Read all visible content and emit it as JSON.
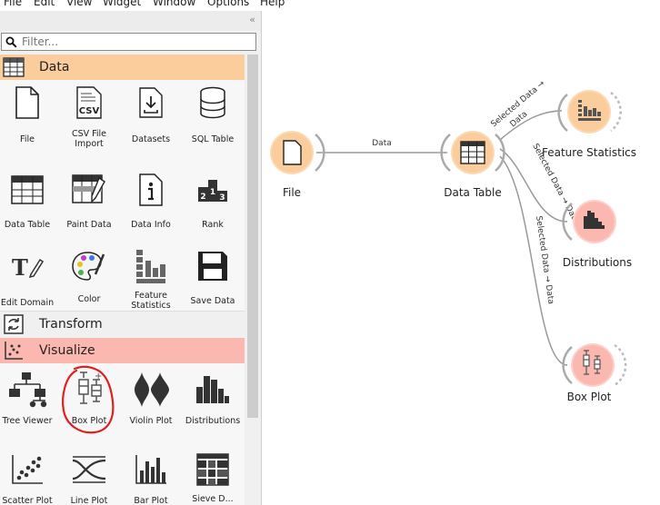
{
  "menubar": {
    "items": [
      "File",
      "Edit",
      "View",
      "Widget",
      "Window",
      "Options",
      "Help"
    ]
  },
  "panel": {
    "collapse_glyph": "«",
    "filter_placeholder": "Filter..."
  },
  "categories": {
    "data": {
      "label": "Data",
      "color": "#fbcd9c",
      "widgets": [
        {
          "label": "File",
          "icon": "file-icon"
        },
        {
          "label": "CSV File Import",
          "icon": "csv-icon"
        },
        {
          "label": "Datasets",
          "icon": "datasets-icon"
        },
        {
          "label": "SQL Table",
          "icon": "database-icon"
        },
        {
          "label": "Data Table",
          "icon": "table-icon"
        },
        {
          "label": "Paint Data",
          "icon": "paint-icon"
        },
        {
          "label": "Data Info",
          "icon": "info-icon"
        },
        {
          "label": "Rank",
          "icon": "rank-icon"
        },
        {
          "label": "Edit Domain",
          "icon": "edit-domain-icon"
        },
        {
          "label": "Color",
          "icon": "palette-icon"
        },
        {
          "label": "Feature Statistics",
          "icon": "feature-stats-icon"
        },
        {
          "label": "Save Data",
          "icon": "save-icon"
        }
      ]
    },
    "transform": {
      "label": "Transform"
    },
    "visualize": {
      "label": "Visualize",
      "color": "#fbb8b0",
      "widgets": [
        {
          "label": "Tree Viewer",
          "icon": "tree-icon"
        },
        {
          "label": "Box Plot",
          "icon": "boxplot-icon"
        },
        {
          "label": "Violin Plot",
          "icon": "violin-icon"
        },
        {
          "label": "Distributions",
          "icon": "distributions-icon"
        },
        {
          "label": "Scatter Plot",
          "icon": "scatter-icon"
        },
        {
          "label": "Line Plot",
          "icon": "lineplot-icon"
        },
        {
          "label": "Bar Plot",
          "icon": "barplot-icon"
        },
        {
          "label": "Sieve D...",
          "icon": "sieve-icon"
        }
      ]
    }
  },
  "annotation": {
    "color": "#e02020"
  },
  "canvas": {
    "nodes": [
      {
        "label": "File"
      },
      {
        "label": "Data Table"
      },
      {
        "label": "Feature Statistics"
      },
      {
        "label": "Distributions"
      },
      {
        "label": "Box Plot"
      }
    ],
    "links": [
      {
        "label": "Data"
      },
      {
        "label_line1": "Selected Data →",
        "label_line2": "Data"
      },
      {
        "label": "Selected Data → Data"
      },
      {
        "label": "Selected Data → Data"
      }
    ]
  }
}
